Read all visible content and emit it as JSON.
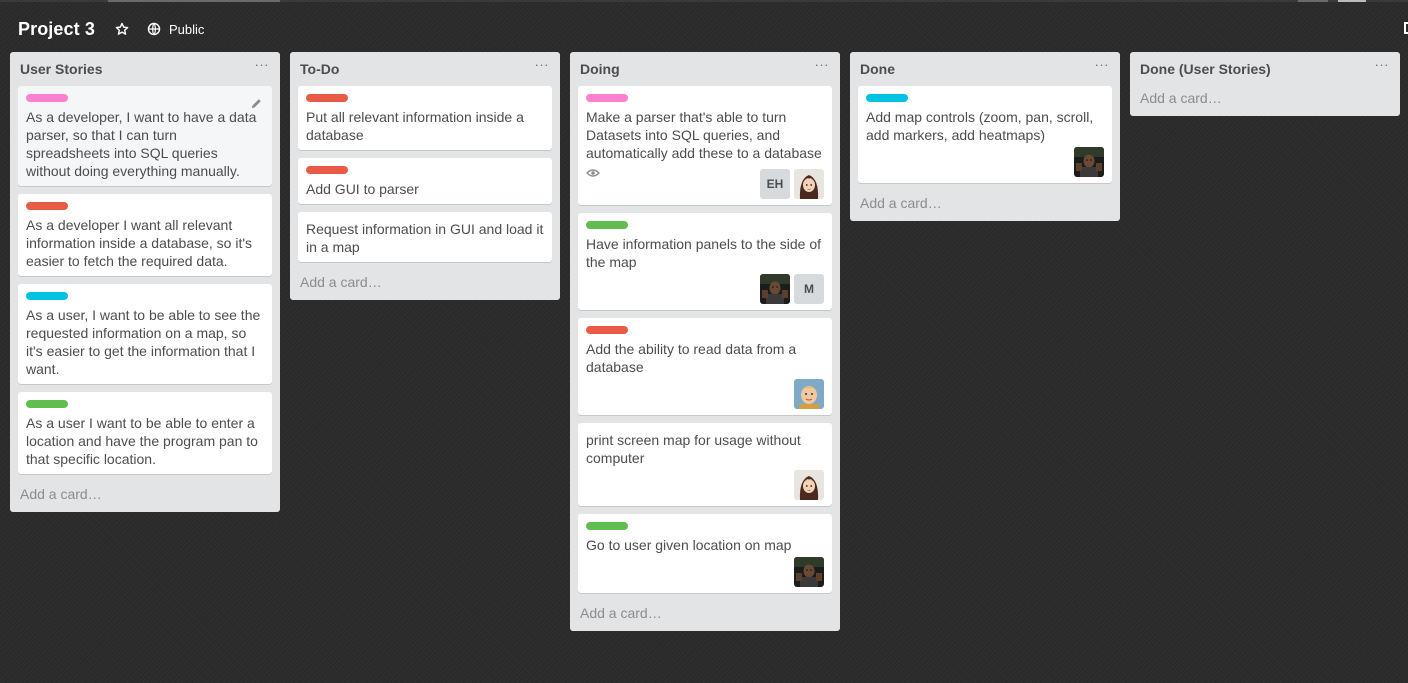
{
  "board": {
    "title": "Project 3",
    "visibility": "Public",
    "star_icon": "star-icon",
    "visibility_icon": "globe-icon"
  },
  "colors": {
    "pink": "#ff80ce",
    "red": "#eb5a46",
    "sky": "#00c2e0",
    "green": "#61bd4f",
    "list_bg": "#e2e4e6",
    "board_bg": "#2b2b2b"
  },
  "add_card_label": "Add a card…",
  "lists": [
    {
      "title": "User Stories",
      "cards": [
        {
          "label": "pink",
          "title": "As a developer, I want to have a data parser, so that I can turn spreadsheets into SQL queries without doing everything manually.",
          "hover": true
        },
        {
          "label": "red",
          "title": "As a developer I want all relevant information inside a database, so it's easier to fetch the required data."
        },
        {
          "label": "sky",
          "title": "As a user, I want to be able to see the requested information on a map, so it's easier to get the information that I want."
        },
        {
          "label": "green",
          "title": "As a user I want to be able to enter a location and have the program pan to that specific location."
        }
      ]
    },
    {
      "title": "To-Do",
      "cards": [
        {
          "label": "red",
          "title": "Put all relevant information inside a database"
        },
        {
          "label": "red",
          "title": "Add GUI to parser"
        },
        {
          "label": null,
          "title": "Request information in GUI and load it in a map"
        }
      ]
    },
    {
      "title": "Doing",
      "cards": [
        {
          "label": "pink",
          "title": "Make a parser that's able to turn Datasets into SQL queries, and automatically add these to a database",
          "watch": true,
          "members": [
            {
              "type": "initials",
              "text": "EH"
            },
            {
              "type": "girl"
            }
          ]
        },
        {
          "label": "green",
          "title": "Have information panels to the side of the map",
          "members": [
            {
              "type": "man"
            },
            {
              "type": "initials",
              "text": "M"
            }
          ]
        },
        {
          "label": "red",
          "title": "Add the ability to read data from a database",
          "members": [
            {
              "type": "boy"
            }
          ]
        },
        {
          "label": null,
          "title": "print screen map for usage without computer",
          "members": [
            {
              "type": "girl"
            }
          ]
        },
        {
          "label": "green",
          "title": "Go to user given location on map",
          "members": [
            {
              "type": "man"
            }
          ]
        }
      ]
    },
    {
      "title": "Done",
      "cards": [
        {
          "label": "sky",
          "title": "Add map controls (zoom, pan, scroll, add markers, add heatmaps)",
          "members": [
            {
              "type": "man"
            }
          ]
        }
      ]
    },
    {
      "title": "Done (User Stories)",
      "cards": []
    }
  ]
}
